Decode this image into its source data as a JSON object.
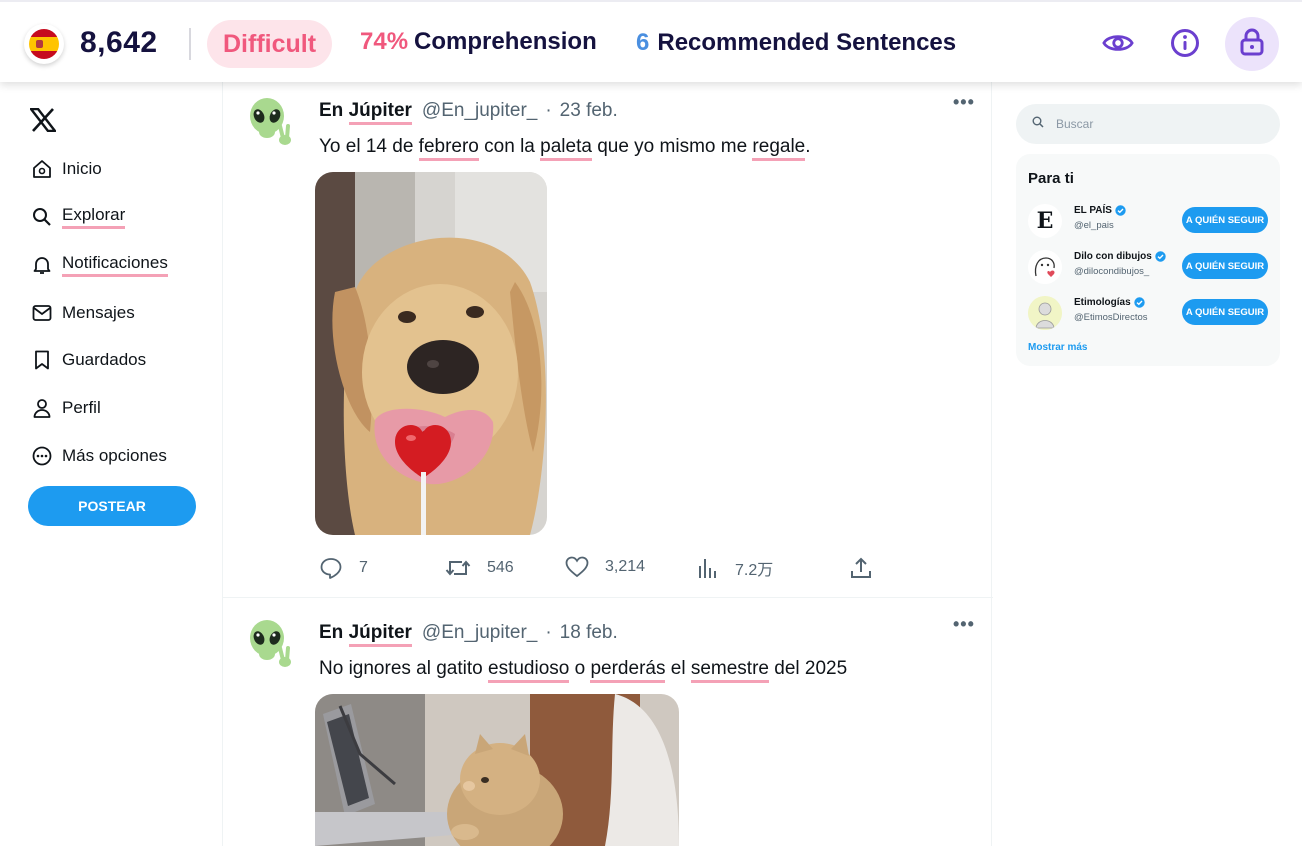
{
  "topbar": {
    "flag_icon": "spain-flag-icon",
    "score": "8,642",
    "difficulty": "Difficult",
    "comprehension_pct": "74%",
    "comprehension_label": "Comprehension",
    "recommended_count": "6",
    "recommended_label": "Recommended Sentences",
    "icons": [
      "eye-icon",
      "info-icon",
      "lock-icon"
    ],
    "colors": {
      "accent_pink": "#f0587d",
      "accent_blue": "#4a8fe0",
      "accent_purple": "#6b3fcf",
      "navy": "#15123f"
    }
  },
  "nav": {
    "logo": "x-logo-icon",
    "items": [
      {
        "label": "Inicio",
        "icon": "home-icon"
      },
      {
        "label": "Explorar",
        "icon": "search-icon"
      },
      {
        "label": "Notificaciones",
        "icon": "bell-icon"
      },
      {
        "label": "Mensajes",
        "icon": "mail-icon"
      },
      {
        "label": "Guardados",
        "icon": "bookmark-icon"
      },
      {
        "label": "Perfil",
        "icon": "person-icon"
      },
      {
        "label": "Más opciones",
        "icon": "more-circle-icon"
      }
    ],
    "post_button": "POSTEAR"
  },
  "feed": {
    "tweets": [
      {
        "name": "En Júpiter",
        "handle": "@En_jupiter_",
        "dot": "·",
        "date": "23 feb.",
        "text": [
          "Yo el 14 de ",
          "febrero",
          " con la ",
          "paleta",
          " que yo mismo me ",
          "regale",
          "."
        ],
        "media": "dog-licking-heart-lollipop-image",
        "replies": "7",
        "retweets": "546",
        "likes": "3,214",
        "views": "7.2万"
      },
      {
        "name": "En Júpiter",
        "handle": "@En_jupiter_",
        "dot": "·",
        "date": "18 feb.",
        "text": [
          "No ignores al gatito ",
          "estudioso",
          " o ",
          "perderás",
          " el ",
          "semestre",
          " del 2025"
        ],
        "media": "kitten-at-laptop-image"
      }
    ]
  },
  "sidebar": {
    "search_placeholder": "Buscar",
    "panel_title": "Para ti",
    "accounts": [
      {
        "name": "EL PAÍS",
        "handle": "@el_pais",
        "follow": "A QUIÉN SEGUIR",
        "avatar_letter": "E"
      },
      {
        "name": "Dilo con dibujos",
        "handle": "@dilocondibujos_",
        "follow": "A QUIÉN SEGUIR"
      },
      {
        "name": "Etimologías",
        "handle": "@EtimosDirectos",
        "follow": "A QUIÉN SEGUIR"
      }
    ],
    "show_more": "Mostrar más"
  }
}
